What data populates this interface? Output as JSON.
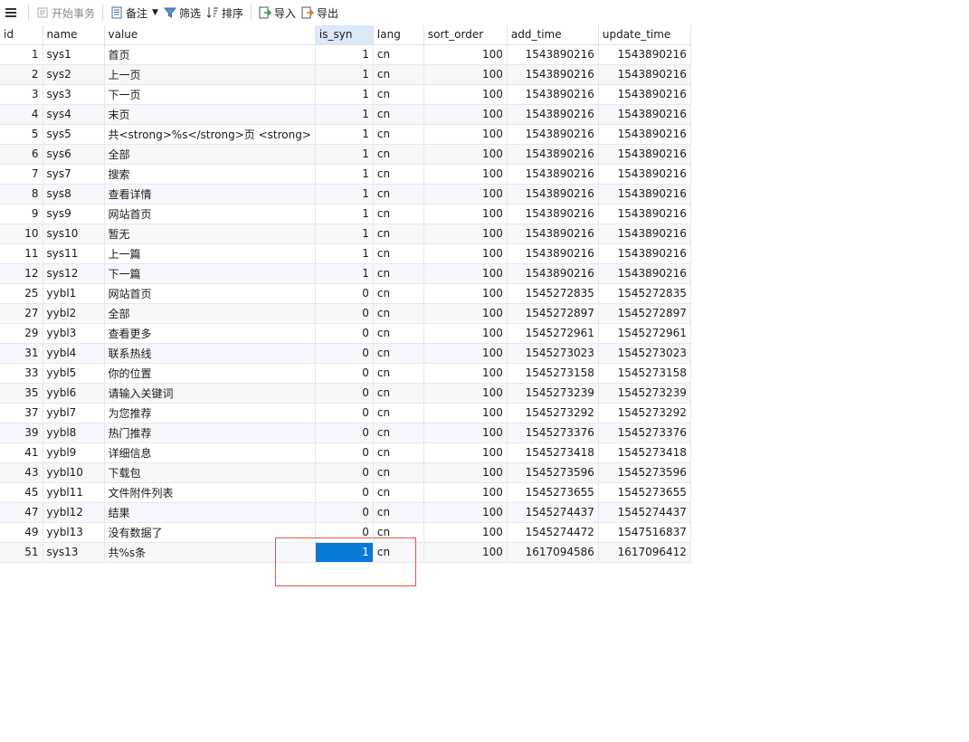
{
  "toolbar": {
    "begin_transaction": "开始事务",
    "memo": "备注",
    "filter": "筛选",
    "sort": "排序",
    "import": "导入",
    "export": "导出"
  },
  "columns": [
    "id",
    "name",
    "value",
    "is_syn",
    "lang",
    "sort_order",
    "add_time",
    "update_time"
  ],
  "rows": [
    [
      "1",
      "sys1",
      "首页",
      "1",
      "cn",
      "100",
      "1543890216",
      "1543890216"
    ],
    [
      "2",
      "sys2",
      "上一页",
      "1",
      "cn",
      "100",
      "1543890216",
      "1543890216"
    ],
    [
      "3",
      "sys3",
      "下一页",
      "1",
      "cn",
      "100",
      "1543890216",
      "1543890216"
    ],
    [
      "4",
      "sys4",
      "末页",
      "1",
      "cn",
      "100",
      "1543890216",
      "1543890216"
    ],
    [
      "5",
      "sys5",
      "共<strong>%s</strong>页 <strong>",
      "1",
      "cn",
      "100",
      "1543890216",
      "1543890216"
    ],
    [
      "6",
      "sys6",
      "全部",
      "1",
      "cn",
      "100",
      "1543890216",
      "1543890216"
    ],
    [
      "7",
      "sys7",
      "搜索",
      "1",
      "cn",
      "100",
      "1543890216",
      "1543890216"
    ],
    [
      "8",
      "sys8",
      "查看详情",
      "1",
      "cn",
      "100",
      "1543890216",
      "1543890216"
    ],
    [
      "9",
      "sys9",
      "网站首页",
      "1",
      "cn",
      "100",
      "1543890216",
      "1543890216"
    ],
    [
      "10",
      "sys10",
      "暂无",
      "1",
      "cn",
      "100",
      "1543890216",
      "1543890216"
    ],
    [
      "11",
      "sys11",
      "上一篇",
      "1",
      "cn",
      "100",
      "1543890216",
      "1543890216"
    ],
    [
      "12",
      "sys12",
      "下一篇",
      "1",
      "cn",
      "100",
      "1543890216",
      "1543890216"
    ],
    [
      "25",
      "yybl1",
      "网站首页",
      "0",
      "cn",
      "100",
      "1545272835",
      "1545272835"
    ],
    [
      "27",
      "yybl2",
      "全部",
      "0",
      "cn",
      "100",
      "1545272897",
      "1545272897"
    ],
    [
      "29",
      "yybl3",
      "查看更多",
      "0",
      "cn",
      "100",
      "1545272961",
      "1545272961"
    ],
    [
      "31",
      "yybl4",
      "联系热线",
      "0",
      "cn",
      "100",
      "1545273023",
      "1545273023"
    ],
    [
      "33",
      "yybl5",
      "你的位置",
      "0",
      "cn",
      "100",
      "1545273158",
      "1545273158"
    ],
    [
      "35",
      "yybl6",
      "请输入关键词",
      "0",
      "cn",
      "100",
      "1545273239",
      "1545273239"
    ],
    [
      "37",
      "yybl7",
      "为您推荐",
      "0",
      "cn",
      "100",
      "1545273292",
      "1545273292"
    ],
    [
      "39",
      "yybl8",
      "热门推荐",
      "0",
      "cn",
      "100",
      "1545273376",
      "1545273376"
    ],
    [
      "41",
      "yybl9",
      "详细信息",
      "0",
      "cn",
      "100",
      "1545273418",
      "1545273418"
    ],
    [
      "43",
      "yybl10",
      "下载包",
      "0",
      "cn",
      "100",
      "1545273596",
      "1545273596"
    ],
    [
      "45",
      "yybl11",
      "文件附件列表",
      "0",
      "cn",
      "100",
      "1545273655",
      "1545273655"
    ],
    [
      "47",
      "yybl12",
      "结果",
      "0",
      "cn",
      "100",
      "1545274437",
      "1545274437"
    ],
    [
      "49",
      "yybl13",
      "没有数据了",
      "0",
      "cn",
      "100",
      "1545274472",
      "1547516837"
    ],
    [
      "51",
      "sys13",
      "共%s条",
      "1",
      "cn",
      "100",
      "1617094586",
      "1617096412"
    ]
  ],
  "selected_cell": {
    "row": 25,
    "column": "is_syn"
  },
  "active_column": "is_syn",
  "colors": {
    "selection": "#0a78d7",
    "active_header": "#dbe8f6",
    "annotation_box": "#e05353"
  }
}
